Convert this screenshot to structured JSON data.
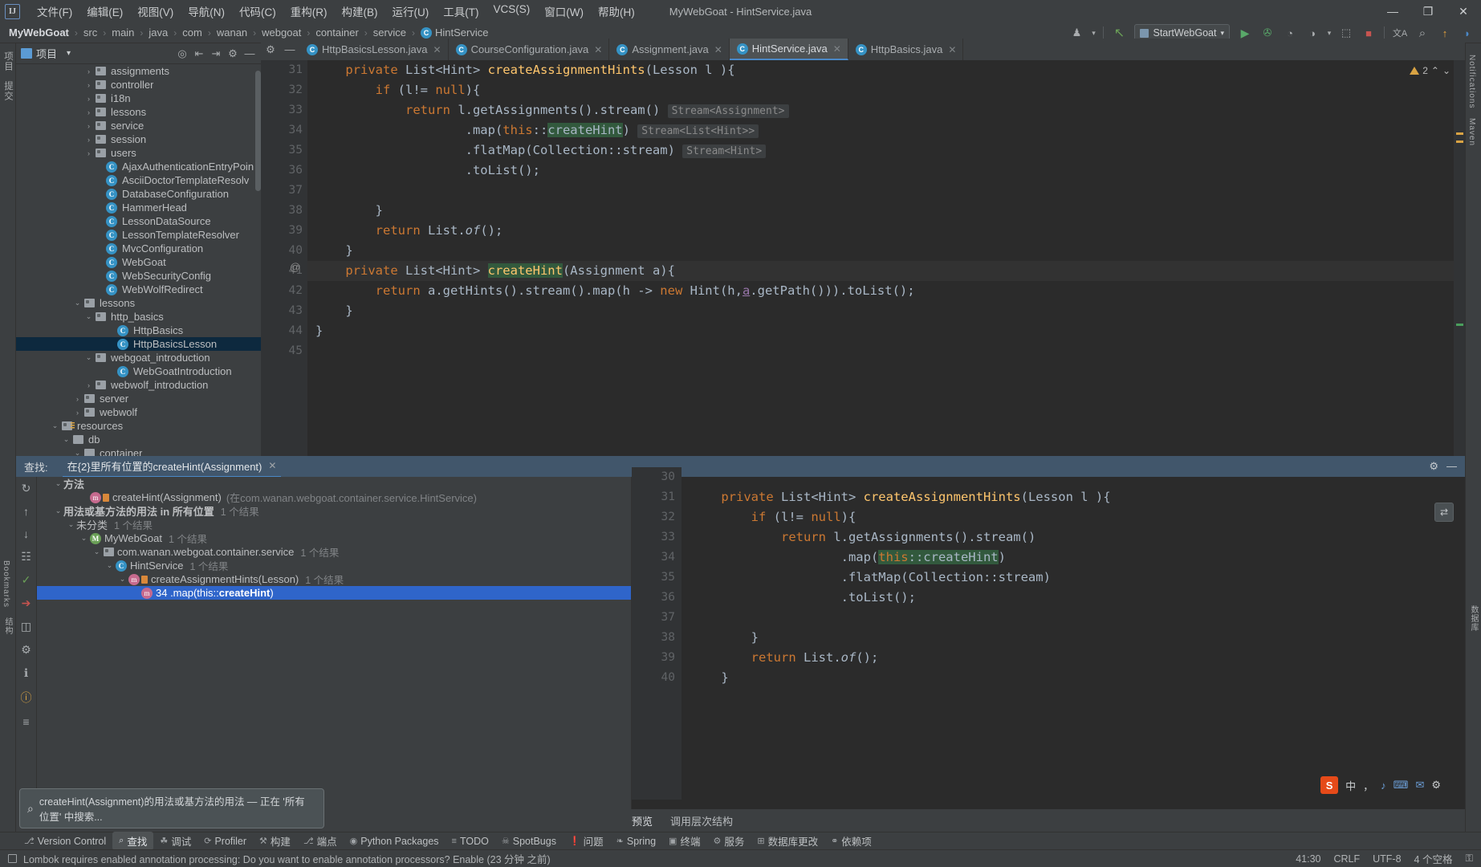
{
  "window": {
    "title": "MyWebGoat - HintService.java",
    "minimize": "—",
    "maximize": "❐",
    "close": "✕"
  },
  "menu": {
    "logo": "IJ",
    "items": [
      "文件(F)",
      "编辑(E)",
      "视图(V)",
      "导航(N)",
      "代码(C)",
      "重构(R)",
      "构建(B)",
      "运行(U)",
      "工具(T)",
      "VCS(S)",
      "窗口(W)",
      "帮助(H)"
    ]
  },
  "breadcrumb": {
    "items": [
      "MyWebGoat",
      "src",
      "main",
      "java",
      "com",
      "wanan",
      "webgoat",
      "container",
      "service",
      "HintService"
    ],
    "separator": "›",
    "class_badge": "C"
  },
  "toolbar": {
    "user_icon": "♟",
    "dropdown": "▾",
    "build_icon": "↖",
    "run_config": "StartWebGoat",
    "run_icon": "▶",
    "debug_icon": "✇",
    "coverage_icon": "◔",
    "profile_icon": "◑",
    "attach_icon": "⬚",
    "stop_icon": "■",
    "translate_icon": "文A",
    "search_icon": "⌕",
    "update_icon": "↑",
    "plugin_icon": "◗"
  },
  "rails": {
    "left": [
      "项目",
      "提交",
      "结构",
      "Bookmarks"
    ],
    "right": [
      "Notifications",
      "Maven",
      "数据库"
    ]
  },
  "project_tool": {
    "title": "项目",
    "dropdown": "▾",
    "icons": [
      "locate-icon",
      "collapse-icon",
      "expand-icon",
      "settings-icon",
      "hide-icon"
    ],
    "tree": [
      {
        "indent": 6,
        "arrow": "›",
        "icon": "folder",
        "label": "assignments"
      },
      {
        "indent": 6,
        "arrow": "›",
        "icon": "folder",
        "label": "controller"
      },
      {
        "indent": 6,
        "arrow": "›",
        "icon": "folder",
        "label": "i18n"
      },
      {
        "indent": 6,
        "arrow": "›",
        "icon": "folder",
        "label": "lessons"
      },
      {
        "indent": 6,
        "arrow": "›",
        "icon": "folder",
        "label": "service"
      },
      {
        "indent": 6,
        "arrow": "›",
        "icon": "folder",
        "label": "session"
      },
      {
        "indent": 6,
        "arrow": "›",
        "icon": "folder",
        "label": "users"
      },
      {
        "indent": 7,
        "arrow": "",
        "icon": "class",
        "label": "AjaxAuthenticationEntryPoin"
      },
      {
        "indent": 7,
        "arrow": "",
        "icon": "class",
        "label": "AsciiDoctorTemplateResolv"
      },
      {
        "indent": 7,
        "arrow": "",
        "icon": "class",
        "label": "DatabaseConfiguration"
      },
      {
        "indent": 7,
        "arrow": "",
        "icon": "class",
        "label": "HammerHead"
      },
      {
        "indent": 7,
        "arrow": "",
        "icon": "class",
        "label": "LessonDataSource"
      },
      {
        "indent": 7,
        "arrow": "",
        "icon": "class",
        "label": "LessonTemplateResolver"
      },
      {
        "indent": 7,
        "arrow": "",
        "icon": "class",
        "label": "MvcConfiguration"
      },
      {
        "indent": 7,
        "arrow": "",
        "icon": "class-run",
        "label": "WebGoat"
      },
      {
        "indent": 7,
        "arrow": "",
        "icon": "class",
        "label": "WebSecurityConfig"
      },
      {
        "indent": 7,
        "arrow": "",
        "icon": "class",
        "label": "WebWolfRedirect"
      },
      {
        "indent": 5,
        "arrow": "⌄",
        "icon": "folder",
        "label": "lessons"
      },
      {
        "indent": 6,
        "arrow": "⌄",
        "icon": "folder",
        "label": "http_basics"
      },
      {
        "indent": 8,
        "arrow": "",
        "icon": "class",
        "label": "HttpBasics"
      },
      {
        "indent": 8,
        "arrow": "",
        "icon": "class",
        "label": "HttpBasicsLesson",
        "selected": true
      },
      {
        "indent": 6,
        "arrow": "⌄",
        "icon": "folder",
        "label": "webgoat_introduction"
      },
      {
        "indent": 8,
        "arrow": "",
        "icon": "class",
        "label": "WebGoatIntroduction"
      },
      {
        "indent": 6,
        "arrow": "›",
        "icon": "folder",
        "label": "webwolf_introduction"
      },
      {
        "indent": 5,
        "arrow": "›",
        "icon": "folder",
        "label": "server"
      },
      {
        "indent": 5,
        "arrow": "›",
        "icon": "folder",
        "label": "webwolf"
      },
      {
        "indent": 3,
        "arrow": "⌄",
        "icon": "resources",
        "label": "resources"
      },
      {
        "indent": 4,
        "arrow": "⌄",
        "icon": "folder-plain",
        "label": "db"
      },
      {
        "indent": 5,
        "arrow": "⌄",
        "icon": "folder-plain",
        "label": "container"
      }
    ]
  },
  "editor": {
    "tabs": [
      {
        "label": "HttpBasicsLesson.java",
        "active": false
      },
      {
        "label": "CourseConfiguration.java",
        "active": false
      },
      {
        "label": "Assignment.java",
        "active": false
      },
      {
        "label": "HintService.java",
        "active": true
      },
      {
        "label": "HttpBasics.java",
        "active": false
      }
    ],
    "tab_close": "✕",
    "tab_settings_icon": "⚙",
    "tab_minimize_icon": "—",
    "warning_count": "2",
    "warning_up": "⌃",
    "warning_down": "⌄",
    "lines": [
      {
        "num": "31",
        "at": "",
        "html": "    <span class=\"kw\">private</span> List&lt;Hint&gt; <span class=\"mth\">createAssignmentHints</span>(Lesson l ){"
      },
      {
        "num": "32",
        "at": "",
        "html": "        <span class=\"kw\">if</span> (l!= <span class=\"kw\">null</span>){"
      },
      {
        "num": "33",
        "at": "",
        "html": "            <span class=\"kw\">return</span> l.getAssignments().stream() <span class=\"hint\">Stream&lt;Assignment&gt;</span>"
      },
      {
        "num": "34",
        "at": "",
        "html": "                    .map(<span class=\"kw\">this</span>::<span class=\"hl\">createHint</span>) <span class=\"hint\">Stream&lt;List&lt;Hint&gt;&gt;</span>"
      },
      {
        "num": "35",
        "at": "",
        "html": "                    .flatMap(Collection::stream) <span class=\"hint\">Stream&lt;Hint&gt;</span>"
      },
      {
        "num": "36",
        "at": "",
        "html": "                    .toList();"
      },
      {
        "num": "37",
        "at": "",
        "html": ""
      },
      {
        "num": "38",
        "at": "",
        "html": "        }"
      },
      {
        "num": "39",
        "at": "",
        "html": "        <span class=\"kw\">return</span> List.<span class=\"ital\">of</span>();"
      },
      {
        "num": "40",
        "at": "",
        "html": "    }"
      },
      {
        "num": "41",
        "at": "@",
        "html": "    <span class=\"kw\">private</span> List&lt;Hint&gt; <span class=\"hl mth\">createHint</span>(Assignment a){",
        "current": true
      },
      {
        "num": "42",
        "at": "",
        "html": "        <span class=\"kw\">return</span> a.getHints().stream().map(h -&gt; <span class=\"kw\">new</span> Hint(h,<span class=\"fld-u\">a</span>.getPath())).toList();"
      },
      {
        "num": "43",
        "at": "",
        "html": "    }"
      },
      {
        "num": "44",
        "at": "",
        "html": "}"
      },
      {
        "num": "45",
        "at": "",
        "html": ""
      }
    ]
  },
  "find": {
    "label": "查找:",
    "tab_title": "在{2}里所有位置的createHint(Assignment)",
    "tab_close": "✕",
    "settings_icon": "⚙",
    "minimize_icon": "—",
    "rail_icons": [
      "rerun-icon",
      "prev-occurrence-icon",
      "export-icon",
      "group-icon",
      "filter-icon",
      "preview-icon",
      "settings-icon",
      "info-icon",
      "help-icon",
      "expand-icon"
    ],
    "results": [
      {
        "indent": 1,
        "arrow": "⌄",
        "icon": "",
        "label": "方法",
        "count": "",
        "bold": true
      },
      {
        "indent": 3,
        "arrow": "",
        "icon": "method-lock",
        "label": "createHint(Assignment)",
        "pkg": "(在com.wanan.webgoat.container.service.HintService)",
        "count": ""
      },
      {
        "indent": 1,
        "arrow": "⌄",
        "icon": "",
        "label": "用法或基方法的用法 in 所有位置",
        "count": "1 个结果",
        "bold": true
      },
      {
        "indent": 2,
        "arrow": "⌄",
        "icon": "",
        "label": "未分类",
        "count": "1 个结果"
      },
      {
        "indent": 3,
        "arrow": "⌄",
        "icon": "module",
        "label": "MyWebGoat",
        "count": "1 个结果"
      },
      {
        "indent": 4,
        "arrow": "⌄",
        "icon": "package",
        "label": "com.wanan.webgoat.container.service",
        "count": "1 个结果"
      },
      {
        "indent": 5,
        "arrow": "⌄",
        "icon": "class",
        "label": "HintService",
        "count": "1 个结果"
      },
      {
        "indent": 6,
        "arrow": "⌄",
        "icon": "method-lock",
        "label": "createAssignmentHints(Lesson)",
        "count": "1 个结果"
      },
      {
        "indent": 7,
        "arrow": "",
        "icon": "method",
        "label": "34 .map(this::createHint)",
        "count": "",
        "selected": true,
        "boldpart": "createHint"
      }
    ],
    "search_bubble": {
      "icon": "⌕",
      "text": "createHint(Assignment)的用法或基方法的用法 — 正在 '所有位置' 中搜索..."
    }
  },
  "preview": {
    "lines": [
      {
        "num": "30",
        "html": ""
      },
      {
        "num": "31",
        "html": "    <span class=\"kw\">private</span> List&lt;Hint&gt; <span class=\"mth\">createAssignmentHints</span>(Lesson l ){"
      },
      {
        "num": "32",
        "html": "        <span class=\"kw\">if</span> (l!= <span class=\"kw\">null</span>){"
      },
      {
        "num": "33",
        "html": "            <span class=\"kw\">return</span> l.getAssignments().stream()"
      },
      {
        "num": "34",
        "html": "                    .map(<span class=\"hl\"><span class=\"kw\">this</span>::createHint</span>)"
      },
      {
        "num": "35",
        "html": "                    .flatMap(Collection::stream)"
      },
      {
        "num": "36",
        "html": "                    .toList();"
      },
      {
        "num": "37",
        "html": ""
      },
      {
        "num": "38",
        "html": "        }"
      },
      {
        "num": "39",
        "html": "        <span class=\"kw\">return</span> List.<span class=\"ital\">of</span>();"
      },
      {
        "num": "40",
        "html": "    }"
      }
    ],
    "toggle_icon": "⇄",
    "tabs": [
      {
        "label": "预览",
        "active": true
      },
      {
        "label": "调用层次结构",
        "active": false
      }
    ]
  },
  "ime": {
    "sogou": "S",
    "items": [
      "中",
      "，",
      "♪",
      "⌨",
      "✉",
      "⚙"
    ]
  },
  "bottom_bar": {
    "items": [
      {
        "icon": "⎇",
        "label": "Version Control",
        "active": false
      },
      {
        "icon": "⌕",
        "label": "查找",
        "active": true
      },
      {
        "icon": "☘",
        "label": "调试",
        "active": false
      },
      {
        "icon": "⟳",
        "label": "Profiler",
        "active": false
      },
      {
        "icon": "⚒",
        "label": "构建",
        "active": false
      },
      {
        "icon": "⎇",
        "label": "端点",
        "active": false
      },
      {
        "icon": "◉",
        "label": "Python Packages",
        "active": false
      },
      {
        "icon": "≡",
        "label": "TODO",
        "active": false
      },
      {
        "icon": "☠",
        "label": "SpotBugs",
        "active": false
      },
      {
        "icon": "❗",
        "label": "问题",
        "active": false
      },
      {
        "icon": "❧",
        "label": "Spring",
        "active": false
      },
      {
        "icon": "▣",
        "label": "终端",
        "active": false
      },
      {
        "icon": "⚙",
        "label": "服务",
        "active": false
      },
      {
        "icon": "⊞",
        "label": "数据库更改",
        "active": false
      },
      {
        "icon": "⚭",
        "label": "依赖项",
        "active": false
      }
    ]
  },
  "status_bar": {
    "icon": "⬚",
    "message": "Lombok requires enabled annotation processing: Do you want to enable annotation processors? Enable (23 分钟 之前)",
    "position": "41:30",
    "line_sep": "CRLF",
    "encoding": "UTF-8",
    "indent": "4 个空格",
    "lock_icon": "⚿"
  }
}
